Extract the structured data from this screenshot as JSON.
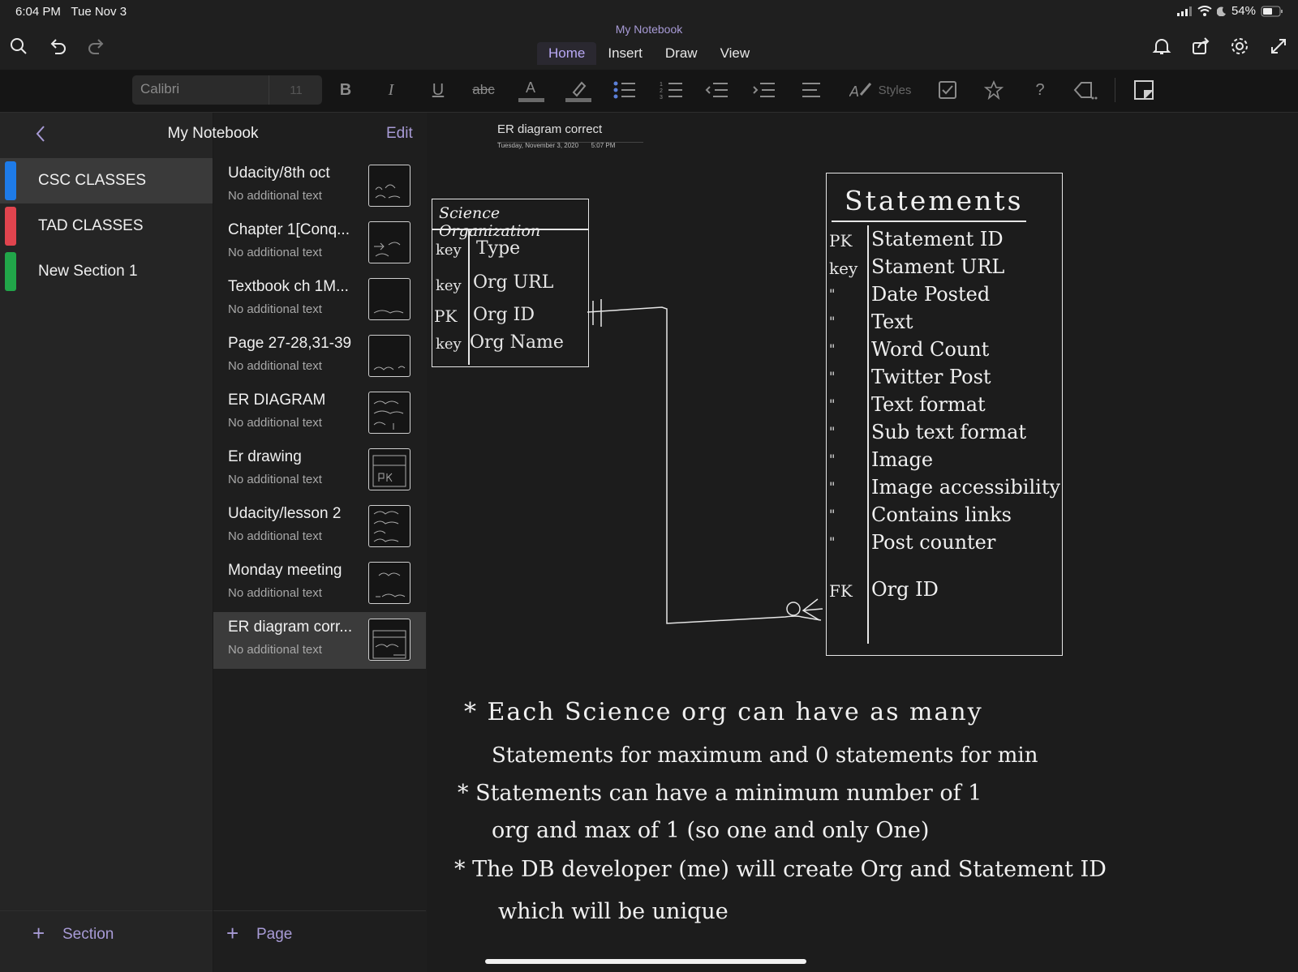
{
  "status": {
    "time": "6:04 PM",
    "date": "Tue Nov 3",
    "battery": "54%"
  },
  "header": {
    "notebook_title": "My Notebook",
    "tabs": [
      "Home",
      "Insert",
      "Draw",
      "View"
    ],
    "active_tab": "Home"
  },
  "ribbon": {
    "font_name": "Calibri",
    "font_size": "11",
    "styles_label": "Styles"
  },
  "sections_panel": {
    "back_label": "<",
    "title": "My Notebook",
    "edit_label": "Edit",
    "items": [
      {
        "label": "CSC CLASSES",
        "color": "#1e7be8"
      },
      {
        "label": "TAD CLASSES",
        "color": "#e0444e"
      },
      {
        "label": "New Section 1",
        "color": "#21a649"
      }
    ],
    "add_section_label": "Section"
  },
  "pages_panel": {
    "items": [
      {
        "title": "Udacity/8th oct",
        "sub": "No additional text"
      },
      {
        "title": "Chapter 1[Conq...",
        "sub": "No additional text"
      },
      {
        "title": "Textbook ch 1M...",
        "sub": "No additional text"
      },
      {
        "title": "Page 27-28,31-39",
        "sub": "No additional text"
      },
      {
        "title": "ER DIAGRAM",
        "sub": "No additional text"
      },
      {
        "title": "Er drawing",
        "sub": "No additional text"
      },
      {
        "title": "Udacity/lesson 2",
        "sub": "No additional text"
      },
      {
        "title": "Monday meeting",
        "sub": "No additional text"
      },
      {
        "title": "ER diagram corr...",
        "sub": "No additional text"
      }
    ],
    "add_page_label": "Page"
  },
  "page": {
    "title": "ER diagram correct",
    "date": "Tuesday, November 3, 2020",
    "time": "5:07 PM",
    "entity1": {
      "name": "Science Organization",
      "rows": [
        {
          "k": "key",
          "v": "Type"
        },
        {
          "k": "key",
          "v": "Org URL"
        },
        {
          "k": "PK",
          "v": "Org ID"
        },
        {
          "k": "key",
          "v": "Org Name"
        }
      ]
    },
    "entity2": {
      "name": "Statements",
      "rows": [
        {
          "k": "PK",
          "v": "Statement ID"
        },
        {
          "k": "key",
          "v": "Stament URL"
        },
        {
          "k": "\"",
          "v": "Date Posted"
        },
        {
          "k": "\"",
          "v": "Text"
        },
        {
          "k": "\"",
          "v": "Word Count"
        },
        {
          "k": "\"",
          "v": "Twitter Post"
        },
        {
          "k": "\"",
          "v": "Text format"
        },
        {
          "k": "\"",
          "v": "Sub text format"
        },
        {
          "k": "\"",
          "v": "Image"
        },
        {
          "k": "\"",
          "v": "Image accessibility"
        },
        {
          "k": "\"",
          "v": "Contains links"
        },
        {
          "k": "\"",
          "v": "Post counter"
        },
        {
          "k": "FK",
          "v": "Org ID"
        }
      ]
    },
    "notes": [
      "* Each Science org can have as many",
      "Statements for maximum and 0 statements for min",
      "* Statements can have a minimum number of 1",
      "org and max of 1 (so one and only One)",
      "* The DB developer (me) will create Org and Statement ID",
      "which will be unique"
    ]
  }
}
